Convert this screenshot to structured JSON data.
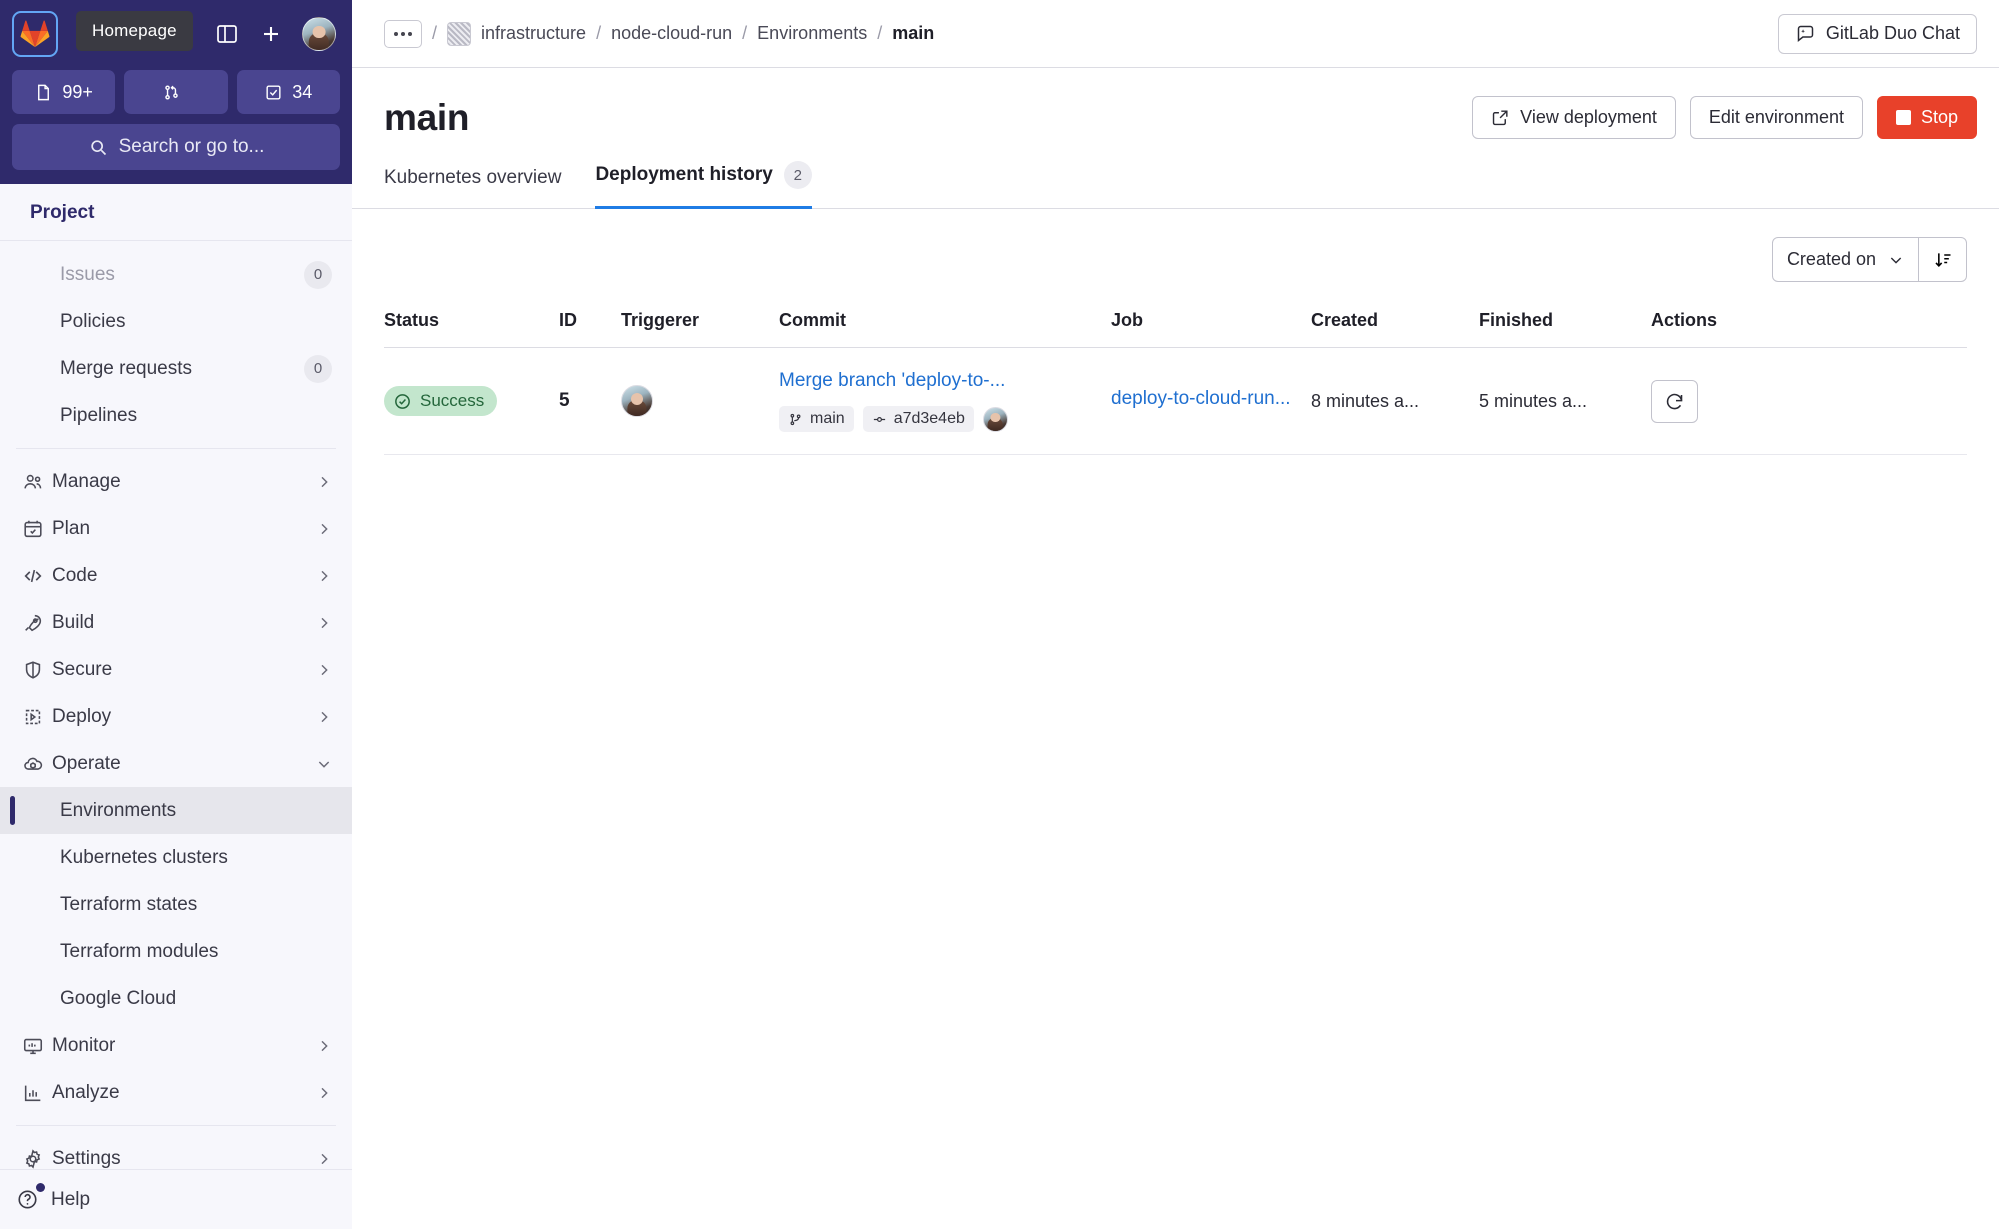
{
  "sidebar": {
    "logo_tooltip": "Homepage",
    "counters": [
      {
        "icon": "issues-icon",
        "label": "99+"
      },
      {
        "icon": "merge-request-icon",
        "label": ""
      },
      {
        "icon": "todo-check-icon",
        "label": "34"
      }
    ],
    "search_placeholder": "Search or go to...",
    "section_title": "Project",
    "quick_items": [
      {
        "label": "Issues",
        "badge": "0",
        "muted": true
      },
      {
        "label": "Policies",
        "badge": "",
        "muted": false
      },
      {
        "label": "Merge requests",
        "badge": "0",
        "muted": false
      },
      {
        "label": "Pipelines",
        "badge": "",
        "muted": false
      }
    ],
    "groups": [
      {
        "label": "Manage",
        "icon": "users-icon",
        "expanded": false
      },
      {
        "label": "Plan",
        "icon": "calendar-icon",
        "expanded": false
      },
      {
        "label": "Code",
        "icon": "code-icon",
        "expanded": false
      },
      {
        "label": "Build",
        "icon": "rocket-icon",
        "expanded": false
      },
      {
        "label": "Secure",
        "icon": "shield-icon",
        "expanded": false
      },
      {
        "label": "Deploy",
        "icon": "deploy-icon",
        "expanded": false
      },
      {
        "label": "Operate",
        "icon": "cloud-icon",
        "expanded": true
      }
    ],
    "operate_children": [
      {
        "label": "Environments",
        "active": true
      },
      {
        "label": "Kubernetes clusters",
        "active": false
      },
      {
        "label": "Terraform states",
        "active": false
      },
      {
        "label": "Terraform modules",
        "active": false
      },
      {
        "label": "Google Cloud",
        "active": false
      }
    ],
    "groups_after": [
      {
        "label": "Monitor",
        "icon": "monitor-icon"
      },
      {
        "label": "Analyze",
        "icon": "analytics-icon"
      }
    ],
    "settings": {
      "label": "Settings",
      "icon": "gear-icon"
    },
    "help": {
      "label": "Help",
      "icon": "question-icon"
    }
  },
  "topbar": {
    "breadcrumb": [
      {
        "label": "infrastructure",
        "type": "group"
      },
      {
        "label": "node-cloud-run",
        "type": "project"
      },
      {
        "label": "Environments",
        "type": "section"
      },
      {
        "label": "main",
        "type": "current"
      }
    ],
    "separator": "/",
    "duo_chat_label": "GitLab Duo Chat"
  },
  "page": {
    "title": "main",
    "actions": [
      {
        "label": "View deployment",
        "icon": "external-link-icon",
        "style": "default"
      },
      {
        "label": "Edit environment",
        "icon": "",
        "style": "default"
      },
      {
        "label": "Stop",
        "icon": "stop-square-icon",
        "style": "danger"
      }
    ],
    "tabs": [
      {
        "label": "Kubernetes overview",
        "badge": "",
        "active": false
      },
      {
        "label": "Deployment history",
        "badge": "2",
        "active": true
      }
    ],
    "sort": {
      "selected": "Created on",
      "direction_icon": "sort-descending-icon"
    }
  },
  "table": {
    "headers": [
      "Status",
      "ID",
      "Triggerer",
      "Commit",
      "Job",
      "Created",
      "Finished",
      "Actions"
    ],
    "rows": [
      {
        "status": "Success",
        "status_icon": "check-circle-icon",
        "id": "5",
        "triggerer_avatar": "user-avatar",
        "commit_title": "Merge branch 'deploy-to-...",
        "commit_branch": "main",
        "commit_sha": "a7d3e4eb",
        "job": "deploy-to-cloud-run...",
        "created": "8 minutes a...",
        "finished": "5 minutes a...",
        "action_icon": "redeploy-icon"
      }
    ]
  },
  "colors": {
    "brand_navy": "#2f2a6b",
    "accent_blue": "#1f7ce5",
    "link_blue": "#1f6fd0",
    "danger_red": "#e8412a",
    "success_bg": "#c3e6cd",
    "success_fg": "#24663b"
  }
}
